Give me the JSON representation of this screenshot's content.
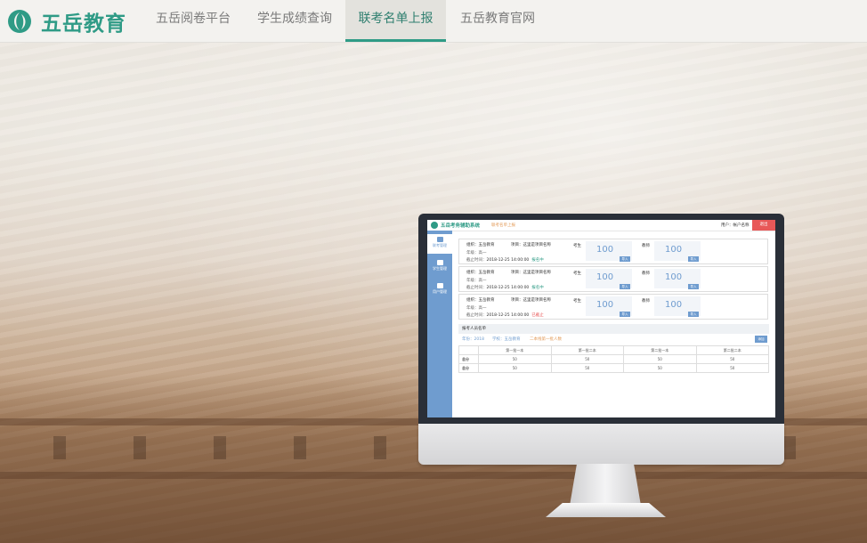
{
  "nav": {
    "brand": "五岳教育",
    "items": [
      {
        "label": "五岳阅卷平台",
        "active": false
      },
      {
        "label": "学生成绩查询",
        "active": false
      },
      {
        "label": "联考名单上报",
        "active": true
      },
      {
        "label": "五岳教育官网",
        "active": false
      }
    ]
  },
  "colors": {
    "brand": "#2f9b86",
    "accent": "#6f9ccf",
    "logout": "#e85858"
  },
  "preview": {
    "app_title": "五岳考务辅助系统",
    "app_sub": "联考名单上报",
    "user": "用户：帐户名称",
    "logout": "退出",
    "side": [
      {
        "label": "联考管理",
        "icon": "list-icon",
        "selected": true
      },
      {
        "label": "学生管理",
        "icon": "graduation-cap-icon",
        "selected": false
      },
      {
        "label": "用户管理",
        "icon": "user-icon",
        "selected": false
      }
    ],
    "cards": [
      {
        "org": "组织：五岳教育",
        "proj": "项目：这里是项目名称",
        "grade": "年级：高一",
        "deadline_label": "截止时间：",
        "deadline": "2018-12-25 14:00:00",
        "status": "报名中",
        "status_color": "#2f9b86",
        "lab1": "考生",
        "num1": "100",
        "lab2": "教师",
        "num2": "100",
        "btn": "导入"
      },
      {
        "org": "组织：五岳教育",
        "proj": "项目：这里是项目名称",
        "grade": "年级：高一",
        "deadline_label": "截止时间：",
        "deadline": "2018-12-25 14:00:00",
        "status": "报名中",
        "status_color": "#2f9b86",
        "lab1": "考生",
        "num1": "100",
        "lab2": "教师",
        "num2": "100",
        "btn": "导入"
      },
      {
        "org": "组织：五岳教育",
        "proj": "项目：这里是项目名称",
        "grade": "年级：高一",
        "deadline_label": "截止时间：",
        "deadline": "2018-12-25 14:00:00",
        "status": "已截止",
        "status_color": "#e85858",
        "lab1": "考生",
        "num1": "100",
        "lab2": "教师",
        "num2": "100",
        "btn": "导入"
      }
    ],
    "section": {
      "title": "报考人员名单",
      "filter": "年份：2018　　学校：五岳教育",
      "warn": "二本线第一批人数",
      "add": "添加",
      "columns": [
        "",
        "第一批一本",
        "第一批二本",
        "第二批一本",
        "第二批二本"
      ],
      "rows": [
        {
          "label": "总分",
          "values": [
            "50",
            "50",
            "50",
            "50"
          ]
        },
        {
          "label": "总分",
          "values": [
            "50",
            "50",
            "50",
            "50"
          ]
        }
      ]
    }
  }
}
